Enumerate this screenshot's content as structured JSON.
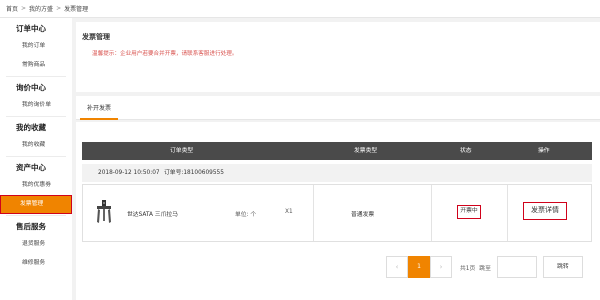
{
  "breadcrumb": {
    "home": "首页",
    "level1": "我的方盛",
    "level2": "发票管理"
  },
  "sidebar": {
    "groups": [
      {
        "title": "订单中心",
        "items": [
          "我的订单",
          "常购商品"
        ]
      },
      {
        "title": "询价中心",
        "items": [
          "我的询价单"
        ]
      },
      {
        "title": "我的收藏",
        "items": [
          "我的收藏"
        ]
      },
      {
        "title": "资产中心",
        "items": [
          "我的优惠劵",
          "发票管理"
        ]
      },
      {
        "title": "售后服务",
        "items": [
          "退货服务",
          "维修服务"
        ]
      }
    ],
    "active_item": "发票管理"
  },
  "main": {
    "title": "发票管理",
    "notice": "温馨提示：企业用户若要合并开票，请联系客服进行处理。",
    "tabs": [
      {
        "label": "补开发票"
      }
    ]
  },
  "table": {
    "headers": [
      "订单类型",
      "发票类型",
      "状态",
      "操作"
    ],
    "order": {
      "date": "2018-09-12 10:50:07",
      "order_no_label": "订单号:18100609555",
      "product_name": "世达SATA 三爪拉马",
      "unit": "单位: 个",
      "qty": "X1",
      "invoice_type": "普通发票",
      "status": "开票中",
      "action": "发票详情"
    }
  },
  "pager": {
    "prev": "‹",
    "current": "1",
    "next": "›",
    "total": "共1页",
    "goto": "跳至",
    "go_btn": "跳转"
  },
  "colors": {
    "accent": "#f08400",
    "highlight": "#d0021b",
    "header_bg": "#4a4a4a"
  }
}
